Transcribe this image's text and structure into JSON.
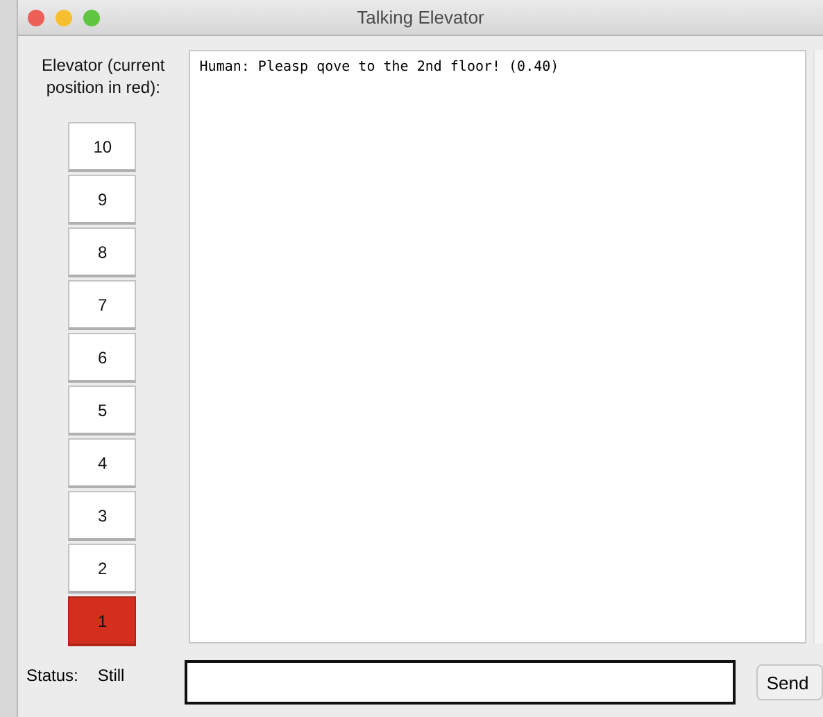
{
  "window": {
    "title": "Talking Elevator"
  },
  "elevator_label": "Elevator (current position in red):",
  "floors": [
    {
      "label": "10",
      "current": false
    },
    {
      "label": "9",
      "current": false
    },
    {
      "label": "8",
      "current": false
    },
    {
      "label": "7",
      "current": false
    },
    {
      "label": "6",
      "current": false
    },
    {
      "label": "5",
      "current": false
    },
    {
      "label": "4",
      "current": false
    },
    {
      "label": "3",
      "current": false
    },
    {
      "label": "2",
      "current": false
    },
    {
      "label": "1",
      "current": true
    }
  ],
  "log": [
    "Human: Pleasp qove to the 2nd floor! (0.40)"
  ],
  "status": {
    "label": "Status:",
    "value": "Still"
  },
  "send_button": "Send"
}
